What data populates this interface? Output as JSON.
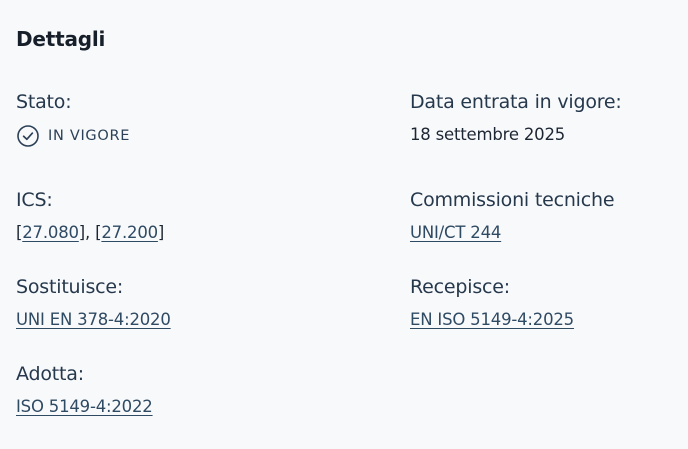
{
  "section_title": "Dettagli",
  "stato": {
    "label": "Stato:",
    "value": "IN VIGORE",
    "icon": "check-circle-icon"
  },
  "data_entrata": {
    "label": "Data entrata in vigore:",
    "value": "18 settembre 2025"
  },
  "ics": {
    "label": "ICS:",
    "codes": [
      "27.080",
      "27.200"
    ]
  },
  "commissioni": {
    "label": "Commissioni tecniche",
    "link": "UNI/CT 244"
  },
  "sostituisce": {
    "label": "Sostituisce:",
    "link": "UNI EN 378-4:2020"
  },
  "recepisce": {
    "label": "Recepisce:",
    "link": "EN ISO 5149-4:2025"
  },
  "adotta": {
    "label": "Adotta:",
    "link": "ISO 5149-4:2022"
  },
  "colors": {
    "text": "#1f2d3d",
    "link": "#2f4a63",
    "background": "#f8f9fb"
  }
}
